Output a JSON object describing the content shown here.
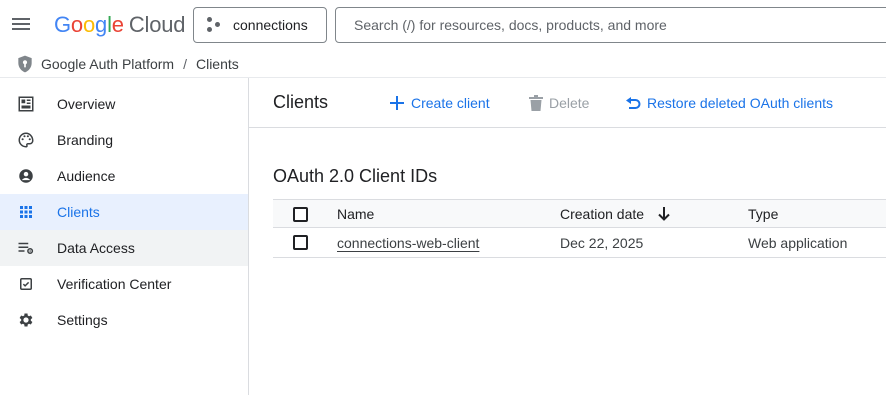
{
  "header": {
    "logo_google": "Google",
    "logo_cloud": "Cloud",
    "project_name": "connections",
    "search_placeholder": "Search (/) for resources, docs, products, and more"
  },
  "breadcrumb": {
    "root": "Google Auth Platform",
    "separator": "/",
    "current": "Clients"
  },
  "sidebar": {
    "items": [
      {
        "label": "Overview",
        "icon": "dashboard-icon"
      },
      {
        "label": "Branding",
        "icon": "palette-icon"
      },
      {
        "label": "Audience",
        "icon": "account-circle-icon"
      },
      {
        "label": "Clients",
        "icon": "apps-grid-icon",
        "active": true
      },
      {
        "label": "Data Access",
        "icon": "data-access-icon"
      },
      {
        "label": "Verification Center",
        "icon": "verification-icon"
      },
      {
        "label": "Settings",
        "icon": "gear-icon"
      }
    ]
  },
  "toolbar": {
    "title": "Clients",
    "create_label": "Create client",
    "delete_label": "Delete",
    "restore_label": "Restore deleted OAuth clients"
  },
  "clients_table": {
    "section_title": "OAuth 2.0 Client IDs",
    "columns": {
      "name": "Name",
      "creation_date": "Creation date",
      "type": "Type"
    },
    "rows": [
      {
        "name": "connections-web-client",
        "creation_date": "Dec 22, 2025",
        "type": "Web application"
      }
    ]
  },
  "colors": {
    "accent": "#1a73e8",
    "active_bg": "#e8f0fe",
    "hover_bg": "#f1f3f4"
  }
}
